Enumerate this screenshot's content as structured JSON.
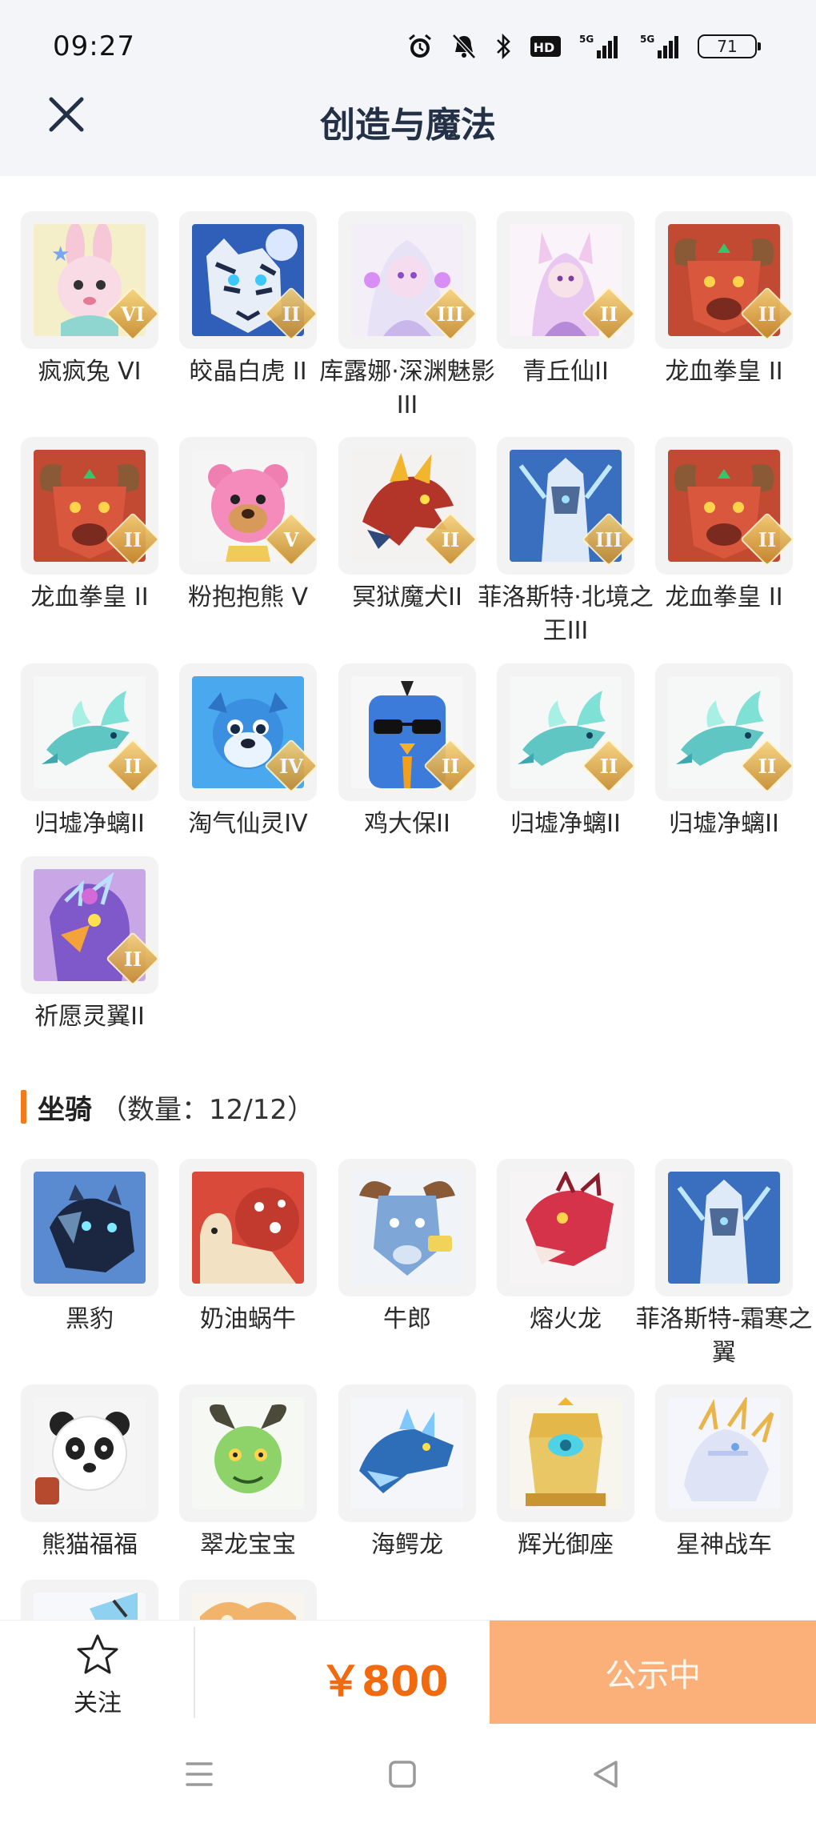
{
  "status_bar": {
    "time": "09:27",
    "signal_1": "5G",
    "signal_2": "5G",
    "hd_label": "HD",
    "battery": "71"
  },
  "header": {
    "title": "创造与魔法"
  },
  "pets": [
    {
      "name": "疯疯兔 VI",
      "grade": "VI",
      "art": "bunny"
    },
    {
      "name": "皎晶白虎 II",
      "grade": "II",
      "art": "tiger"
    },
    {
      "name": "库露娜·深渊魅影III",
      "grade": "III",
      "art": "lady-white"
    },
    {
      "name": "青丘仙II",
      "grade": "II",
      "art": "fox-lady"
    },
    {
      "name": "龙血拳皇 II",
      "grade": "II",
      "art": "ram-red"
    },
    {
      "name": "龙血拳皇 II",
      "grade": "II",
      "art": "ram-red"
    },
    {
      "name": "粉抱抱熊 V",
      "grade": "V",
      "art": "bear-pink"
    },
    {
      "name": "冥狱魔犬II",
      "grade": "II",
      "art": "dragon-red"
    },
    {
      "name": "菲洛斯特·北境之王III",
      "grade": "III",
      "art": "ice-knight"
    },
    {
      "name": "龙血拳皇 II",
      "grade": "II",
      "art": "ram-red"
    },
    {
      "name": "归墟净螭II",
      "grade": "II",
      "art": "dragon-cyan"
    },
    {
      "name": "淘气仙灵IV",
      "grade": "IV",
      "art": "dog-blue"
    },
    {
      "name": "鸡大保II",
      "grade": "II",
      "art": "bird-blue"
    },
    {
      "name": "归墟净螭II",
      "grade": "II",
      "art": "dragon-cyan"
    },
    {
      "name": "归墟净螭II",
      "grade": "II",
      "art": "dragon-cyan"
    },
    {
      "name": "祈愿灵翼II",
      "grade": "II",
      "art": "griffin"
    }
  ],
  "mounts_section": {
    "title": "坐骑",
    "count_text": "（数量：12/12）"
  },
  "mounts": [
    {
      "name": "黑豹",
      "art": "panther"
    },
    {
      "name": "奶油蜗牛",
      "art": "snail"
    },
    {
      "name": "牛郎",
      "art": "bull"
    },
    {
      "name": "熔火龙",
      "art": "dragon-lava"
    },
    {
      "name": "菲洛斯特-霜寒之翼",
      "art": "ice-knight"
    },
    {
      "name": "熊猫福福",
      "art": "panda"
    },
    {
      "name": "翠龙宝宝",
      "art": "dragon-green"
    },
    {
      "name": "海鳄龙",
      "art": "sea-croc"
    },
    {
      "name": "辉光御座",
      "art": "throne"
    },
    {
      "name": "星神战车",
      "art": "chariot"
    },
    {
      "name": "",
      "art": "partial-blue"
    },
    {
      "name": "",
      "art": "partial-orange"
    }
  ],
  "action_bar": {
    "follow_label": "关注",
    "price": "￥800",
    "cta_label": "公示中"
  },
  "colors": {
    "accent": "#f26a10",
    "cta_bg": "#fbb07a",
    "title": "#233046",
    "tile_bg": "#f3f3f4"
  }
}
